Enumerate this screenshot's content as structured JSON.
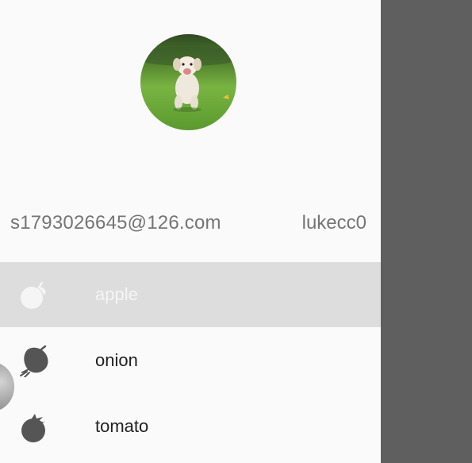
{
  "header": {
    "email": "s1793026645@126.com",
    "username": "lukecc0",
    "avatar_icon": "puppy-photo"
  },
  "menu": {
    "items": [
      {
        "label": "apple",
        "icon": "apple-icon",
        "selected": true
      },
      {
        "label": "onion",
        "icon": "onion-icon",
        "selected": false
      },
      {
        "label": "tomato",
        "icon": "tomato-icon",
        "selected": false
      }
    ]
  },
  "colors": {
    "drawer_bg": "#fafafa",
    "scrim": "#5f5f5f",
    "selected_bg": "#dddddd",
    "icon": "#555555",
    "selected_icon": "#f5f5f5"
  }
}
